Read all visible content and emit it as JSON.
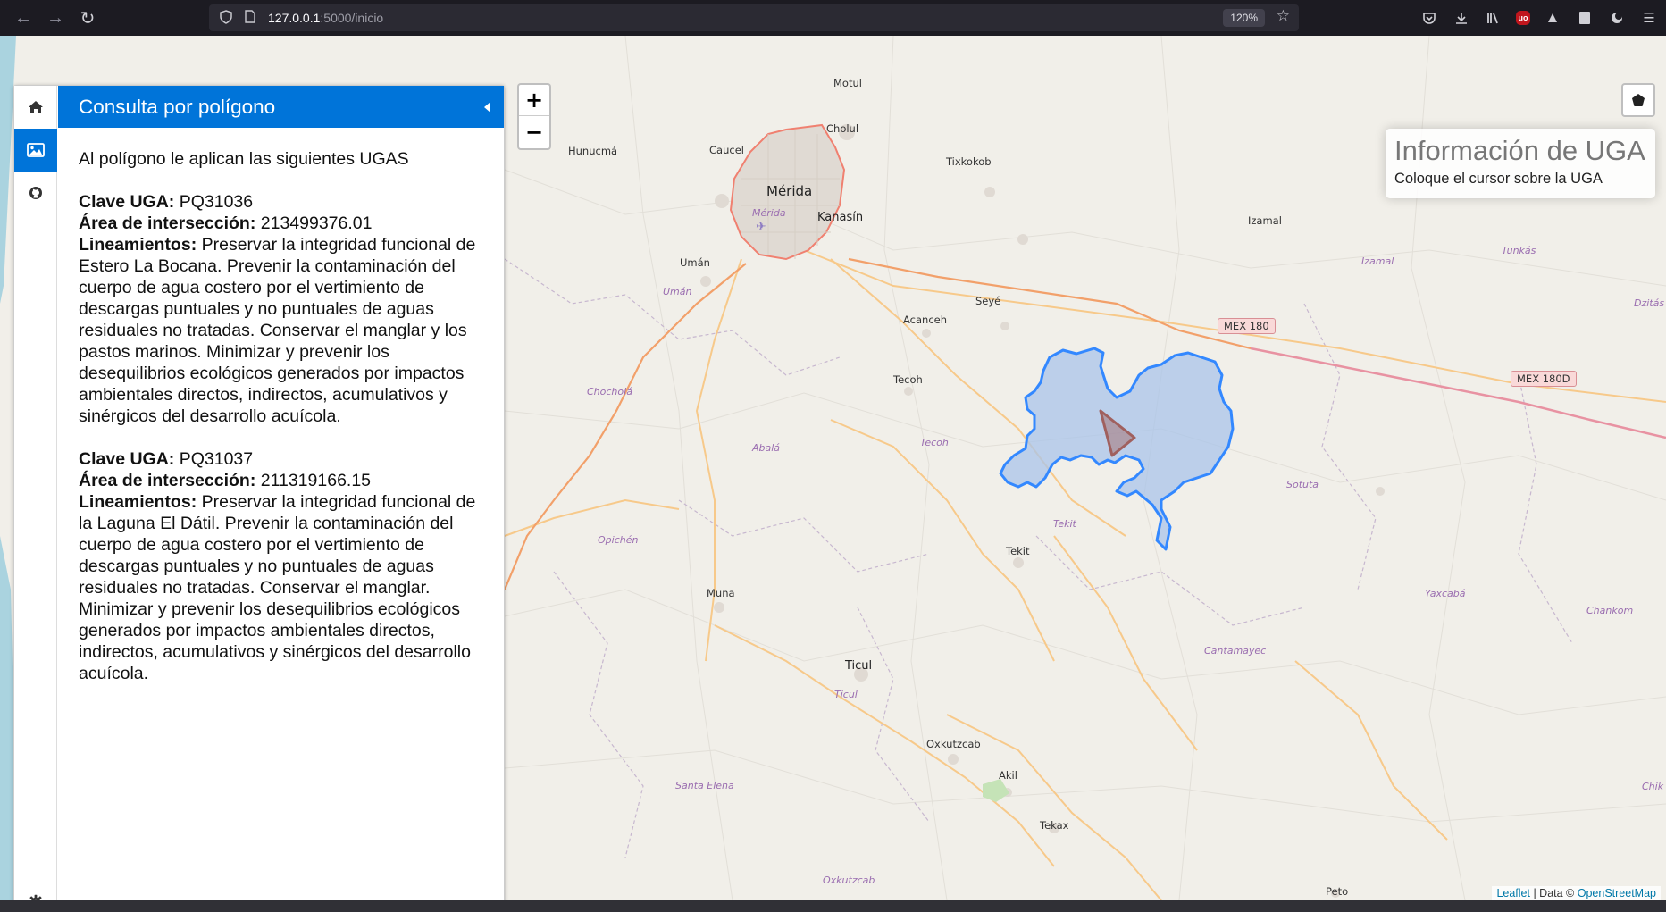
{
  "browser": {
    "url_host": "127.0.0.1",
    "url_rest": ":5000/inicio",
    "zoom": "120%"
  },
  "map": {
    "zoom_in": "+",
    "zoom_out": "−",
    "places_big": [
      {
        "name": "Mérida"
      }
    ],
    "places_mid": [
      {
        "name": "Kanasín"
      },
      {
        "name": "Ticul"
      }
    ],
    "places": [
      {
        "name": "Motul"
      },
      {
        "name": "Cholul"
      },
      {
        "name": "Caucel"
      },
      {
        "name": "Hunucmá"
      },
      {
        "name": "Tixkokob"
      },
      {
        "name": "Izamal"
      },
      {
        "name": "Umán"
      },
      {
        "name": "Seyé"
      },
      {
        "name": "Acanceh"
      },
      {
        "name": "Tecoh"
      },
      {
        "name": "Tekit"
      },
      {
        "name": "Muna"
      },
      {
        "name": "Oxkutzcab"
      },
      {
        "name": "Akil"
      },
      {
        "name": "Tekax"
      },
      {
        "name": "Peto"
      }
    ],
    "places_muni": [
      {
        "name": "Mérida"
      },
      {
        "name": "Umán"
      },
      {
        "name": "Izamal"
      },
      {
        "name": "Tunkás"
      },
      {
        "name": "Dzitás"
      },
      {
        "name": "Chocholá"
      },
      {
        "name": "Tecoh"
      },
      {
        "name": "Abalá"
      },
      {
        "name": "Sotuta"
      },
      {
        "name": "Tekit"
      },
      {
        "name": "Opichén"
      },
      {
        "name": "Yaxcabá"
      },
      {
        "name": "Chankom"
      },
      {
        "name": "Cantamayec"
      },
      {
        "name": "Ticul"
      },
      {
        "name": "Santa Elena"
      },
      {
        "name": "Oxkutzcab"
      },
      {
        "name": "Chik"
      }
    ],
    "shields": [
      {
        "label": "MEX 180"
      },
      {
        "label": "MEX 180D"
      }
    ],
    "colors": {
      "polygon_stroke": "#3388ff",
      "polygon_fill": "#a9c4ea",
      "triangle": "#a0605e",
      "highway": "#e892a2",
      "primary_road": "#f7c98a",
      "urban_boundary": "#f08070"
    }
  },
  "info": {
    "title": "Información de UGA",
    "subtitle": "Coloque el cursor sobre la UGA"
  },
  "attribution": {
    "leaflet": "Leaflet",
    "sep": " | Data © ",
    "osm": "OpenStreetMap"
  },
  "sidebar": {
    "tabs": [
      {
        "icon": "home-icon"
      },
      {
        "icon": "image-icon"
      },
      {
        "icon": "github-icon"
      }
    ],
    "settings_icon": "gear-icon",
    "header": "Consulta por polígono",
    "intro": "Al polígono le aplican las siguientes UGAS",
    "labels": {
      "clave": "Clave UGA:",
      "area": "Área de intersección:",
      "lineamientos": "Lineamientos:"
    },
    "ugas": [
      {
        "clave": "PQ31036",
        "area": "213499376.01",
        "lineamientos": "Preservar la integridad funcional de Estero La Bocana. Prevenir la contaminación del cuerpo de agua costero por el vertimiento de descargas puntuales y no puntuales de aguas residuales no tratadas. Conservar el manglar y los pastos marinos. Minimizar y prevenir los desequilibrios ecológicos generados por impactos ambientales directos, indirectos, acumulativos y sinérgicos del desarrollo acuícola."
      },
      {
        "clave": "PQ31037",
        "area": "211319166.15",
        "lineamientos": "Preservar la integridad funcional de la Laguna El Dátil. Prevenir la contaminación del cuerpo de agua costero por el vertimiento de descargas puntuales y no puntuales de aguas residuales no tratadas. Conservar el manglar. Minimizar y prevenir los desequilibrios ecológicos generados por impactos ambientales directos, indirectos, acumulativos y sinérgicos del desarrollo acuícola."
      }
    ]
  }
}
